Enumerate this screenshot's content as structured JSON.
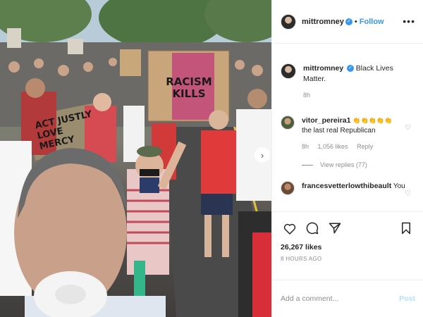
{
  "header": {
    "username": "mittromney",
    "separator": "•",
    "follow_label": "Follow",
    "more_icon": "more-horizontal-icon"
  },
  "photo": {
    "sign_left": "ACT JUSTLY LOVE MERCY",
    "sign_center": "RACISM KILLS",
    "next_icon": "chevron-right-icon"
  },
  "caption": {
    "username": "mittromney",
    "text": "Black Lives Matter.",
    "age": "8h"
  },
  "comments": [
    {
      "username": "vitor_pereira1",
      "emoji": "👏👏👏👏👏",
      "text": "the last real Republican",
      "age": "8h",
      "likes": "1,056 likes",
      "reply_label": "Reply",
      "view_replies": "View replies (77)"
    },
    {
      "username": "francesvetterlowthibeault",
      "text": "You"
    }
  ],
  "actions": {
    "like_icon": "heart-icon",
    "comment_icon": "comment-icon",
    "share_icon": "send-icon",
    "save_icon": "bookmark-icon",
    "likes": "26,267 likes",
    "timestamp": "8 HOURS AGO"
  },
  "add_comment": {
    "placeholder": "Add a comment...",
    "post_label": "Post"
  },
  "colors": {
    "accent": "#3897f0",
    "post_disabled": "#b2dffc",
    "muted": "#8e8e8e"
  }
}
